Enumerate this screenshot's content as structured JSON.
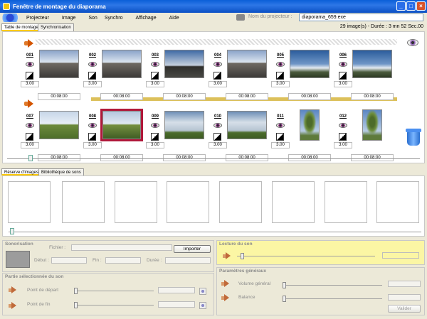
{
  "window": {
    "title": "Fenêtre de montage du diaporama"
  },
  "menu": {
    "items": [
      "Projecteur",
      "Image",
      "Son",
      "Synchro",
      "Affichage",
      "Aide"
    ],
    "projector_label": "Nom du projecteur :",
    "projector_value": "diaporama_659.exe"
  },
  "tabs": {
    "montage": "Table de montage",
    "sync": "Synchronisation"
  },
  "summary": "29 image(s) - Durée : 3 mn 52 Sec.00",
  "row1": [
    {
      "num": "001",
      "dur": "00:08:00",
      "t": "3.00",
      "img": "sky1"
    },
    {
      "num": "002",
      "dur": "00:08:00",
      "t": "3.00",
      "img": "sky1"
    },
    {
      "num": "003",
      "dur": "00:08:00",
      "t": "3.00",
      "img": "sky2"
    },
    {
      "num": "004",
      "dur": "00:08:00",
      "t": "3.00",
      "img": "sky1"
    },
    {
      "num": "005",
      "dur": "00:08:00",
      "t": "3.00",
      "img": "sky3"
    },
    {
      "num": "006",
      "dur": "00:08:00",
      "t": "3.00",
      "img": "sky3"
    }
  ],
  "row2": [
    {
      "num": "007",
      "dur": "00:08:00",
      "t": "3.00",
      "img": "field1"
    },
    {
      "num": "008",
      "dur": "00:08:00",
      "t": "3.00",
      "img": "field2"
    },
    {
      "num": "009",
      "dur": "00:08:00",
      "t": "3.00",
      "img": "cloud1"
    },
    {
      "num": "010",
      "dur": "00:08:00",
      "t": "3.00",
      "img": "cloud1"
    },
    {
      "num": "011",
      "dur": "00:08:00",
      "t": "3.00",
      "img": "tree"
    },
    {
      "num": "012",
      "dur": "00:08:00",
      "t": "3.00",
      "img": "tree"
    }
  ],
  "tabs2": {
    "reserve": "Réserve d'images",
    "sounds": "Bibliothèque de sons"
  },
  "sonorisation": {
    "title": "Sonorisation",
    "fichier": "Fichier :",
    "debut": "Début :",
    "fin": "Fin :",
    "duree": "Durée :",
    "import": "Importer"
  },
  "lecture": {
    "title": "Lecture du son"
  },
  "partie": {
    "title": "Partie sélectionnée du son",
    "start": "Point de départ",
    "end": "Point de fin"
  },
  "params": {
    "title": "Paramètres généraux",
    "volume": "Volume général",
    "balance": "Balance",
    "validate": "Valider"
  }
}
